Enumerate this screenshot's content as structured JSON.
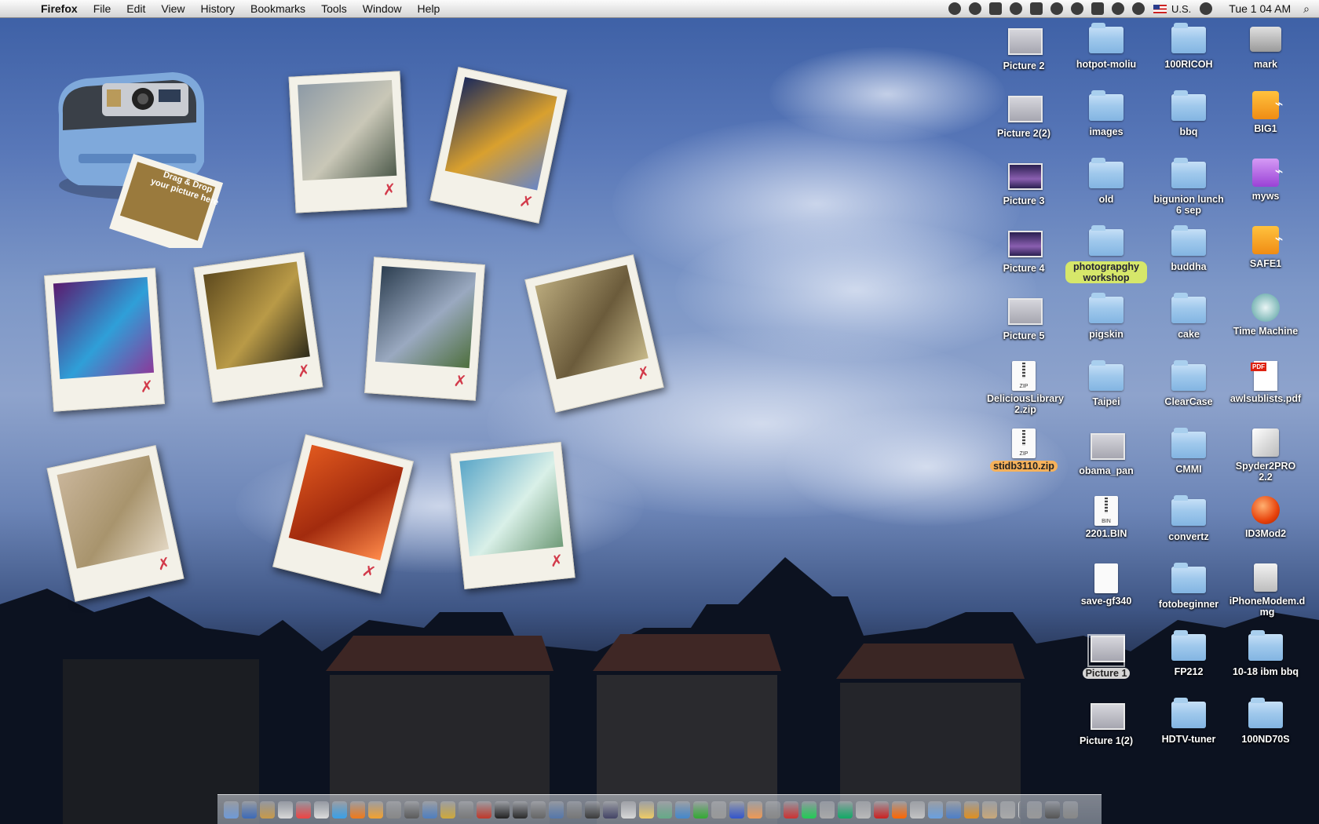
{
  "menubar": {
    "app": "Firefox",
    "items": [
      "File",
      "Edit",
      "View",
      "History",
      "Bookmarks",
      "Tools",
      "Window",
      "Help"
    ],
    "input_source": "U.S.",
    "clock": "Tue 1 04 AM"
  },
  "widget": {
    "camera_text": "Drag & Drop your picture here"
  },
  "desktop_icons": [
    {
      "label": "Picture 2",
      "type": "thumb"
    },
    {
      "label": "hotpot-moliu",
      "type": "folder"
    },
    {
      "label": "100RICOH",
      "type": "folder"
    },
    {
      "label": "mark",
      "type": "disk"
    },
    {
      "label": "Picture 2(2)",
      "type": "thumb"
    },
    {
      "label": "images",
      "type": "folder"
    },
    {
      "label": "bbq",
      "type": "folder"
    },
    {
      "label": "BIG1",
      "type": "usb"
    },
    {
      "label": "Picture 3",
      "type": "thumb-purple"
    },
    {
      "label": "old",
      "type": "folder"
    },
    {
      "label": "bigunion lunch 6 sep",
      "type": "folder"
    },
    {
      "label": "myws",
      "type": "usb-purple"
    },
    {
      "label": "Picture 4",
      "type": "thumb-purple"
    },
    {
      "label": "photograpghy workshop",
      "type": "folder",
      "highlight": "green"
    },
    {
      "label": "buddha",
      "type": "folder"
    },
    {
      "label": "SAFE1",
      "type": "usb"
    },
    {
      "label": "Picture 5",
      "type": "thumb"
    },
    {
      "label": "pigskin",
      "type": "folder"
    },
    {
      "label": "cake",
      "type": "folder"
    },
    {
      "label": "Time Machine",
      "type": "timemachine"
    },
    {
      "label": "DeliciousLibrary2.zip",
      "type": "zip"
    },
    {
      "label": "Taipei",
      "type": "folder"
    },
    {
      "label": "ClearCase",
      "type": "folder"
    },
    {
      "label": "awlsublists.pdf",
      "type": "pdf"
    },
    {
      "label": "stidb3110.zip",
      "type": "zip",
      "highlight": "orange"
    },
    {
      "label": "obama_pan",
      "type": "thumb"
    },
    {
      "label": "CMMI",
      "type": "folder"
    },
    {
      "label": "Spyder2PRO 2.2",
      "type": "s2p"
    },
    {
      "label": "",
      "type": "none"
    },
    {
      "label": "2201.BIN",
      "type": "bin"
    },
    {
      "label": "convertz",
      "type": "folder"
    },
    {
      "label": "ID3Mod2",
      "type": "round"
    },
    {
      "label": "",
      "type": "none"
    },
    {
      "label": "save-gf340",
      "type": "doc"
    },
    {
      "label": "fotobeginner",
      "type": "folder"
    },
    {
      "label": "iPhoneModem.dmg",
      "type": "dmg"
    },
    {
      "label": "",
      "type": "none"
    },
    {
      "label": "Picture 1",
      "type": "thumb",
      "highlight": "gray"
    },
    {
      "label": "FP212",
      "type": "folder"
    },
    {
      "label": "10-18 ibm bbq",
      "type": "folder"
    },
    {
      "label": "",
      "type": "none"
    },
    {
      "label": "Picture 1(2)",
      "type": "thumb"
    },
    {
      "label": "HDTV-tuner",
      "type": "folder"
    },
    {
      "label": "100ND70S",
      "type": "folder"
    }
  ],
  "polaroids": [
    {
      "name": "rail-tracks",
      "colors": [
        "#8d9aa6",
        "#c9c7b7",
        "#4d5a4b"
      ]
    },
    {
      "name": "empire-sign",
      "colors": [
        "#1c2a5a",
        "#d9a02e",
        "#6a86c4"
      ]
    },
    {
      "name": "purple-dog",
      "colors": [
        "#5a1a6e",
        "#2f9fd8",
        "#8b3a9a"
      ]
    },
    {
      "name": "subway-station",
      "colors": [
        "#5e4a1e",
        "#b99a47",
        "#2d2a1a"
      ]
    },
    {
      "name": "photo-collage",
      "colors": [
        "#2c3e50",
        "#9aa9c0",
        "#4e6f3d"
      ]
    },
    {
      "name": "wall-tiles",
      "colors": [
        "#b9a97c",
        "#6b5b3b",
        "#c7b98a"
      ]
    },
    {
      "name": "running-dog",
      "colors": [
        "#c9b59a",
        "#a8946d",
        "#e2d6c2"
      ]
    },
    {
      "name": "red-maze",
      "colors": [
        "#e0581e",
        "#a22b0e",
        "#ff8a4a"
      ]
    },
    {
      "name": "church",
      "colors": [
        "#5aa6c8",
        "#d9f0e8",
        "#6f9b78"
      ]
    }
  ],
  "dock_count": 48
}
